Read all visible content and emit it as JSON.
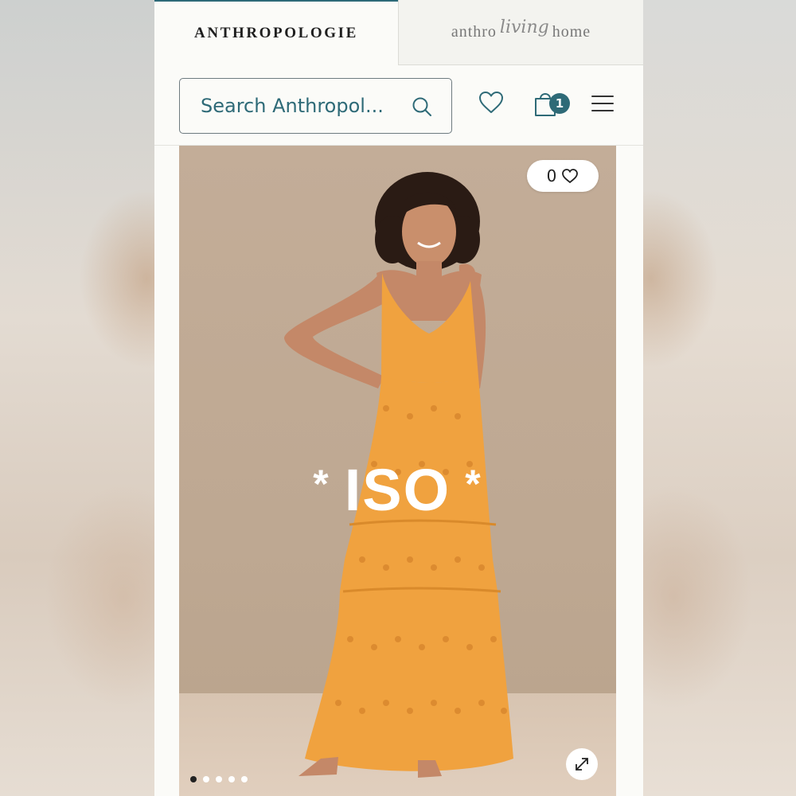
{
  "header": {
    "brand_tabs": [
      {
        "label": "ANTHROPOLOGIE"
      },
      {
        "label_prefix": "anthro",
        "label_script": "living",
        "label_suffix": "home"
      }
    ],
    "search": {
      "placeholder": "Search Anthropol..."
    },
    "icons": {
      "favorites": "heart-icon",
      "cart": "shopping-bag-icon",
      "menu": "hamburger-menu-icon",
      "search": "search-icon"
    },
    "cart_count": "1"
  },
  "product_image": {
    "favorite_count": "0",
    "overlay_text": "ISO",
    "overlay_star": "*",
    "carousel": {
      "total": 5,
      "active_index": 0
    },
    "expand_icon": "expand-arrows-icon",
    "dress_color": "#f0a23f"
  },
  "colors": {
    "accent": "#2e6a77",
    "background": "#fbfbf8"
  }
}
